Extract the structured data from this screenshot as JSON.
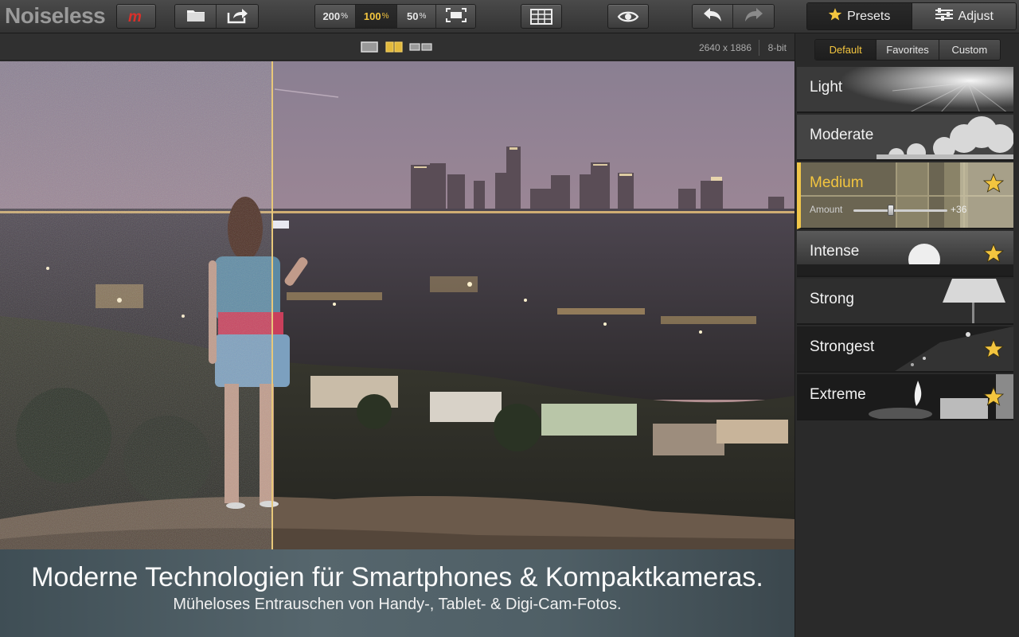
{
  "app": {
    "title": "Noiseless"
  },
  "toolbar": {
    "zoom": [
      {
        "value": "200",
        "unit": "%",
        "active": false
      },
      {
        "value": "100",
        "unit": "%",
        "active": true
      },
      {
        "value": "50",
        "unit": "%",
        "active": false
      }
    ],
    "modes": [
      {
        "label": "Presets",
        "icon": "star-icon",
        "active": true
      },
      {
        "label": "Adjust",
        "icon": "sliders-icon",
        "active": false
      }
    ]
  },
  "viewer": {
    "dimensions": "2640 x 1886",
    "bit_depth": "8-bit"
  },
  "presets_panel": {
    "tabs": [
      {
        "label": "Default",
        "active": true
      },
      {
        "label": "Favorites",
        "active": false
      },
      {
        "label": "Custom",
        "active": false
      }
    ],
    "items": [
      {
        "name": "Light",
        "favorite": false,
        "selected": false
      },
      {
        "name": "Moderate",
        "favorite": false,
        "selected": false
      },
      {
        "name": "Medium",
        "favorite": true,
        "selected": true,
        "amount_label": "Amount",
        "amount_value": "36"
      },
      {
        "name": "Intense",
        "favorite": true,
        "selected": false
      },
      {
        "name": "Strong",
        "favorite": false,
        "selected": false
      },
      {
        "name": "Strongest",
        "favorite": true,
        "selected": false
      },
      {
        "name": "Extreme",
        "favorite": true,
        "selected": false
      }
    ]
  },
  "caption": {
    "title": "Moderne Technologien für Smartphones & Kompaktkameras.",
    "subtitle": "Müheloses Entrauschen von Handy-, Tablet- & Digi-Cam-Fotos."
  },
  "colors": {
    "accent": "#f3c53f",
    "brand_red": "#d9302a"
  }
}
